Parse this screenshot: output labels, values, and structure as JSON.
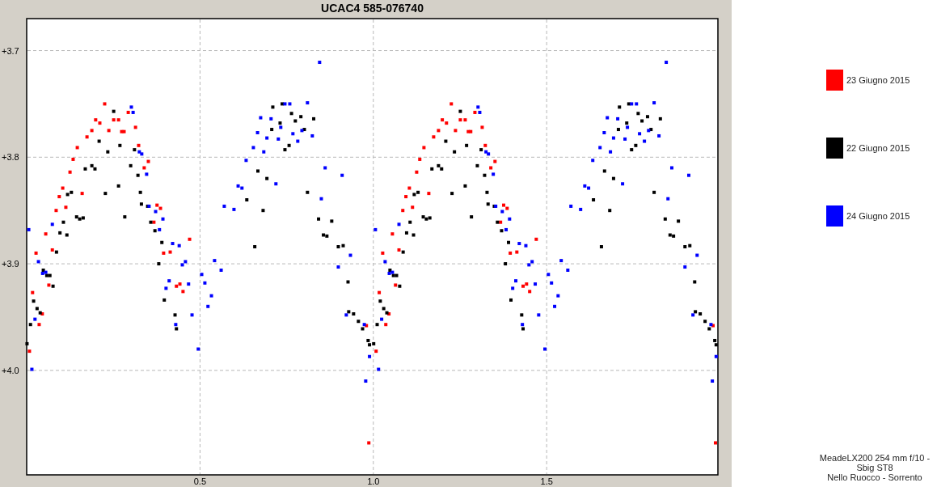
{
  "chart": {
    "chart_data": {
      "type": "scatter",
      "title": "UCAC4 585-076740",
      "grid": true,
      "xlim": [
        0,
        1.994
      ],
      "ylim": [
        4.098,
        3.67
      ],
      "xticks": [
        {
          "value": 0.5,
          "label": "0.5"
        },
        {
          "value": 1.0,
          "label": "1.0"
        },
        {
          "value": 1.5,
          "label": "1.5"
        }
      ],
      "yticks": [
        {
          "value": 3.7,
          "label": "+3.7"
        },
        {
          "value": 3.8,
          "label": "+3.8"
        },
        {
          "value": 3.9,
          "label": "+3.9"
        },
        {
          "value": 4.0,
          "label": "+4.0"
        }
      ],
      "series": [
        {
          "name": "23 Giugno 2015",
          "color": "#ff0000",
          "x": [
            0.008,
            0.017,
            0.027,
            0.036,
            0.045,
            0.055,
            0.064,
            0.074,
            0.085,
            0.094,
            0.104,
            0.113,
            0.125,
            0.134,
            0.146,
            0.16,
            0.174,
            0.188,
            0.199,
            0.211,
            0.225,
            0.237,
            0.251,
            0.265,
            0.274,
            0.281,
            0.293,
            0.314,
            0.323,
            0.339,
            0.351,
            0.367,
            0.376,
            0.386,
            0.395,
            0.414,
            0.432,
            0.442,
            0.451,
            0.47,
            0.98,
            0.987,
            1.008,
            1.017,
            1.027,
            1.036,
            1.045,
            1.055,
            1.064,
            1.074,
            1.085,
            1.094,
            1.104,
            1.113,
            1.125,
            1.134,
            1.146,
            1.16,
            1.174,
            1.188,
            1.199,
            1.211,
            1.225,
            1.237,
            1.251,
            1.265,
            1.274,
            1.281,
            1.293,
            1.314,
            1.323,
            1.339,
            1.351,
            1.367,
            1.376,
            1.386,
            1.395,
            1.414,
            1.432,
            1.442,
            1.451,
            1.47,
            1.98,
            1.987
          ],
          "values": [
            3.982,
            3.927,
            3.89,
            3.957,
            3.947,
            3.872,
            3.92,
            3.887,
            3.85,
            3.837,
            3.829,
            3.847,
            3.814,
            3.802,
            3.791,
            3.834,
            3.781,
            3.775,
            3.765,
            3.768,
            3.75,
            3.775,
            3.765,
            3.765,
            3.776,
            3.776,
            3.758,
            3.772,
            3.789,
            3.81,
            3.804,
            3.861,
            3.845,
            3.848,
            3.89,
            3.889,
            3.921,
            3.919,
            3.926,
            3.877,
            3.958,
            4.068,
            3.982,
            3.927,
            3.89,
            3.957,
            3.947,
            3.872,
            3.92,
            3.887,
            3.85,
            3.837,
            3.829,
            3.847,
            3.814,
            3.802,
            3.791,
            3.834,
            3.781,
            3.775,
            3.765,
            3.768,
            3.75,
            3.775,
            3.765,
            3.765,
            3.776,
            3.776,
            3.758,
            3.772,
            3.789,
            3.81,
            3.804,
            3.861,
            3.845,
            3.848,
            3.89,
            3.889,
            3.921,
            3.919,
            3.926,
            3.877,
            3.958,
            4.068
          ]
        },
        {
          "name": "22 Giugno 2015",
          "color": "#000000",
          "x": [
            0.001,
            0.011,
            0.02,
            0.03,
            0.039,
            0.048,
            0.058,
            0.067,
            0.076,
            0.086,
            0.096,
            0.106,
            0.116,
            0.118,
            0.129,
            0.144,
            0.153,
            0.163,
            0.169,
            0.188,
            0.197,
            0.209,
            0.227,
            0.234,
            0.251,
            0.265,
            0.269,
            0.283,
            0.3,
            0.311,
            0.321,
            0.328,
            0.331,
            0.349,
            0.358,
            0.37,
            0.381,
            0.39,
            0.397,
            0.428,
            0.432,
            0.635,
            0.658,
            0.667,
            0.682,
            0.693,
            0.707,
            0.71,
            0.731,
            0.737,
            0.745,
            0.757,
            0.764,
            0.775,
            0.791,
            0.801,
            0.81,
            0.828,
            0.842,
            0.856,
            0.866,
            0.88,
            0.899,
            0.913,
            0.927,
            0.929,
            0.943,
            0.957,
            0.969,
            0.985,
            0.989,
            1.001,
            1.011,
            1.02,
            1.03,
            1.039,
            1.048,
            1.058,
            1.067,
            1.076,
            1.086,
            1.096,
            1.106,
            1.116,
            1.118,
            1.129,
            1.144,
            1.153,
            1.163,
            1.169,
            1.188,
            1.197,
            1.209,
            1.227,
            1.234,
            1.251,
            1.265,
            1.269,
            1.283,
            1.3,
            1.311,
            1.321,
            1.328,
            1.331,
            1.349,
            1.358,
            1.37,
            1.381,
            1.39,
            1.397,
            1.428,
            1.432,
            1.635,
            1.658,
            1.667,
            1.682,
            1.693,
            1.707,
            1.71,
            1.731,
            1.737,
            1.745,
            1.757,
            1.764,
            1.775,
            1.791,
            1.801,
            1.81,
            1.828,
            1.842,
            1.856,
            1.866,
            1.88,
            1.899,
            1.913,
            1.927,
            1.929,
            1.943,
            1.957,
            1.969,
            1.985,
            1.989
          ],
          "values": [
            3.975,
            3.957,
            3.935,
            3.942,
            3.946,
            3.906,
            3.911,
            3.911,
            3.921,
            3.889,
            3.871,
            3.861,
            3.873,
            3.835,
            3.833,
            3.856,
            3.858,
            3.857,
            3.811,
            3.808,
            3.811,
            3.785,
            3.834,
            3.795,
            3.757,
            3.827,
            3.789,
            3.856,
            3.808,
            3.793,
            3.817,
            3.833,
            3.844,
            3.846,
            3.861,
            3.869,
            3.9,
            3.88,
            3.934,
            3.948,
            3.961,
            3.84,
            3.884,
            3.813,
            3.85,
            3.82,
            3.774,
            3.753,
            3.768,
            3.75,
            3.793,
            3.789,
            3.759,
            3.766,
            3.762,
            3.774,
            3.833,
            3.764,
            3.858,
            3.873,
            3.874,
            3.86,
            3.884,
            3.883,
            3.917,
            3.945,
            3.947,
            3.954,
            3.961,
            3.972,
            3.976,
            3.975,
            3.957,
            3.935,
            3.942,
            3.946,
            3.906,
            3.911,
            3.911,
            3.921,
            3.889,
            3.871,
            3.861,
            3.873,
            3.835,
            3.833,
            3.856,
            3.858,
            3.857,
            3.811,
            3.808,
            3.811,
            3.785,
            3.834,
            3.795,
            3.757,
            3.827,
            3.789,
            3.856,
            3.808,
            3.793,
            3.817,
            3.833,
            3.844,
            3.846,
            3.861,
            3.869,
            3.9,
            3.88,
            3.934,
            3.948,
            3.961,
            3.84,
            3.884,
            3.813,
            3.85,
            3.82,
            3.774,
            3.753,
            3.768,
            3.75,
            3.793,
            3.789,
            3.759,
            3.766,
            3.762,
            3.774,
            3.833,
            3.764,
            3.858,
            3.873,
            3.874,
            3.86,
            3.884,
            3.883,
            3.917,
            3.945,
            3.947,
            3.954,
            3.961,
            3.972,
            3.976
          ]
        },
        {
          "name": "24 Giugno 2015",
          "color": "#0000ff",
          "x": [
            0.006,
            0.015,
            0.024,
            0.034,
            0.046,
            0.055,
            0.074,
            0.302,
            0.307,
            0.325,
            0.332,
            0.346,
            0.353,
            0.372,
            0.383,
            0.393,
            0.402,
            0.411,
            0.421,
            0.43,
            0.44,
            0.449,
            0.458,
            0.467,
            0.477,
            0.495,
            0.505,
            0.514,
            0.523,
            0.533,
            0.542,
            0.561,
            0.57,
            0.598,
            0.61,
            0.621,
            0.633,
            0.654,
            0.666,
            0.675,
            0.684,
            0.693,
            0.705,
            0.719,
            0.726,
            0.733,
            0.745,
            0.759,
            0.768,
            0.782,
            0.794,
            0.81,
            0.824,
            0.845,
            0.85,
            0.861,
            0.899,
            0.91,
            0.922,
            0.934,
            0.974,
            0.978,
            0.989,
            1.006,
            1.015,
            1.024,
            1.034,
            1.046,
            1.055,
            1.074,
            1.302,
            1.307,
            1.325,
            1.332,
            1.346,
            1.353,
            1.372,
            1.383,
            1.393,
            1.402,
            1.411,
            1.421,
            1.43,
            1.44,
            1.449,
            1.458,
            1.467,
            1.477,
            1.495,
            1.505,
            1.514,
            1.523,
            1.533,
            1.542,
            1.561,
            1.57,
            1.598,
            1.61,
            1.621,
            1.633,
            1.654,
            1.666,
            1.675,
            1.684,
            1.693,
            1.705,
            1.719,
            1.726,
            1.733,
            1.745,
            1.759,
            1.768,
            1.782,
            1.794,
            1.81,
            1.824,
            1.845,
            1.85,
            1.861,
            1.899,
            1.91,
            1.922,
            1.934,
            1.974,
            1.978,
            1.989
          ],
          "values": [
            3.868,
            3.999,
            3.952,
            3.898,
            3.909,
            3.908,
            3.863,
            3.753,
            3.758,
            3.795,
            3.797,
            3.816,
            3.846,
            3.851,
            3.868,
            3.858,
            3.923,
            3.916,
            3.881,
            3.957,
            3.883,
            3.901,
            3.898,
            3.919,
            3.948,
            3.98,
            3.91,
            3.918,
            3.94,
            3.93,
            3.897,
            3.906,
            3.846,
            3.849,
            3.827,
            3.829,
            3.803,
            3.791,
            3.777,
            3.763,
            3.795,
            3.782,
            3.764,
            3.825,
            3.783,
            3.772,
            3.75,
            3.75,
            3.778,
            3.785,
            3.775,
            3.749,
            3.78,
            3.711,
            3.839,
            3.81,
            3.903,
            3.817,
            3.948,
            3.892,
            3.957,
            4.01,
            3.987,
            3.868,
            3.999,
            3.952,
            3.898,
            3.909,
            3.908,
            3.863,
            3.753,
            3.758,
            3.795,
            3.797,
            3.816,
            3.846,
            3.851,
            3.868,
            3.858,
            3.923,
            3.916,
            3.881,
            3.957,
            3.883,
            3.901,
            3.898,
            3.919,
            3.948,
            3.98,
            3.91,
            3.918,
            3.94,
            3.93,
            3.897,
            3.906,
            3.846,
            3.849,
            3.827,
            3.829,
            3.803,
            3.791,
            3.777,
            3.763,
            3.795,
            3.782,
            3.764,
            3.825,
            3.783,
            3.772,
            3.75,
            3.75,
            3.778,
            3.785,
            3.775,
            3.749,
            3.78,
            3.711,
            3.839,
            3.81,
            3.903,
            3.817,
            3.948,
            3.892,
            3.957,
            4.01,
            3.987
          ]
        }
      ]
    }
  },
  "footer": {
    "lines": [
      "MeadeLX200 254 mm f/10 -",
      "Sbig ST8",
      "Nello Ruocco - Sorrento"
    ]
  }
}
